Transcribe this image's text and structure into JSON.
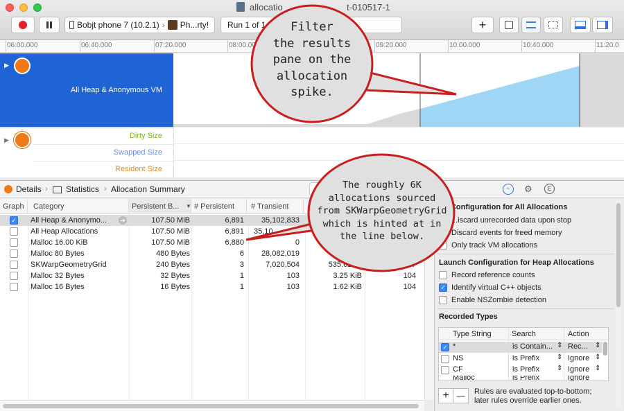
{
  "window": {
    "title": "allocations-2017-01-05-010517-1",
    "title_visible": "allocatio",
    "title_tail": "t-010517-1",
    "traffic_colors": [
      "#fc605b",
      "#fdbc40",
      "#34c84a"
    ]
  },
  "toolbar": {
    "device_label": "Bobjt phone 7 (10.2.1)",
    "process_label": "Ph...rty!",
    "run_label": "Run 1 of 1"
  },
  "ruler": {
    "ticks": [
      "06:00.000",
      "06:40.000",
      "07:20.000",
      "08:00.000",
      "09:20.000",
      "10:00.000",
      "10:40.000",
      "11:20.0"
    ]
  },
  "tracks": {
    "main_label": "All Heap & Anonymous VM",
    "sub_rows": [
      "Dirty Size",
      "Swapped Size",
      "Resident Size"
    ],
    "colors": {
      "dirty": "#7ab51d",
      "swapped": "#6b8fe0",
      "resident": "#e48a22",
      "selection": "#1f63d4",
      "graph_fill": "#9fd6f5"
    }
  },
  "details_bar": {
    "items": [
      "Details",
      "Statistics",
      "Allocation Summary"
    ]
  },
  "table": {
    "columns": [
      "Graph",
      "Category",
      "Persistent B...",
      "# Persistent",
      "# Transient"
    ],
    "rows": [
      {
        "checked": true,
        "category": "All Heap & Anonymo...",
        "persistent_bytes": "107.50 MiB",
        "num_persistent": "6,891",
        "num_transient": "35,102,833",
        "extra1": "",
        "extra2": ""
      },
      {
        "checked": false,
        "category": "All Heap Allocations",
        "persistent_bytes": "107.50 MiB",
        "num_persistent": "6,891",
        "num_transient": "35,10",
        "extra1": "",
        "extra2": ""
      },
      {
        "checked": false,
        "category": "Malloc 16.00 KiB",
        "persistent_bytes": "107.50 MiB",
        "num_persistent": "6,880",
        "num_transient": "0",
        "extra1": "",
        "extra2": ""
      },
      {
        "checked": false,
        "category": "Malloc 80 Bytes",
        "persistent_bytes": "480 Bytes",
        "num_persistent": "6",
        "num_transient": "28,082,019",
        "extra1": "",
        "extra2": ""
      },
      {
        "checked": false,
        "category": "SKWarpGeometryGrid",
        "persistent_bytes": "240 Bytes",
        "num_persistent": "3",
        "num_transient": "7,020,504",
        "extra1": "535.62 Mi",
        "extra2": "7"
      },
      {
        "checked": false,
        "category": "Malloc 32 Bytes",
        "persistent_bytes": "32 Bytes",
        "num_persistent": "1",
        "num_transient": "103",
        "extra1": "3.25 KiB",
        "extra2": "104"
      },
      {
        "checked": false,
        "category": "Malloc 16 Bytes",
        "persistent_bytes": "16 Bytes",
        "num_persistent": "1",
        "num_transient": "103",
        "extra1": "1.62 KiB",
        "extra2": "104"
      }
    ]
  },
  "inspector": {
    "section1_title": "...h Configuration for All Allocations",
    "section1_items": [
      {
        "label": "...iscard unrecorded data upon stop",
        "checked": false
      },
      {
        "label": "Discard events for freed memory",
        "checked": false
      },
      {
        "label": "Only track VM allocations",
        "checked": false
      }
    ],
    "section2_title": "Launch Configuration for Heap Allocations",
    "section2_items": [
      {
        "label": "Record reference counts",
        "checked": false
      },
      {
        "label": "Identify virtual C++ objects",
        "checked": true
      },
      {
        "label": "Enable NSZombie detection",
        "checked": false
      }
    ],
    "recorded_types_title": "Recorded Types",
    "rt_columns": [
      "Type String",
      "Search",
      "Action"
    ],
    "rt_rows": [
      {
        "checked": true,
        "type": "*",
        "search": "is Contain...",
        "action": "Rec..."
      },
      {
        "checked": false,
        "type": "NS",
        "search": "is Prefix",
        "action": "Ignore"
      },
      {
        "checked": false,
        "type": "CF",
        "search": "is Prefix",
        "action": "Ignore"
      },
      {
        "checked": false,
        "type": "Malloc",
        "search": "is Prefix",
        "action": "Ignore"
      }
    ],
    "rules_note_1": "Rules are evaluated top-to-bottom;",
    "rules_note_2": "later rules override earlier ones.",
    "add_label": "+",
    "remove_label": "—"
  },
  "callouts": {
    "top": [
      "Filter",
      "the results",
      "pane on the",
      "allocation",
      "spike."
    ],
    "bottom": [
      "The roughly 6K",
      "allocations sourced",
      "from SKWarpGeometryGrid",
      "which is hinted at in",
      "the line below."
    ]
  }
}
